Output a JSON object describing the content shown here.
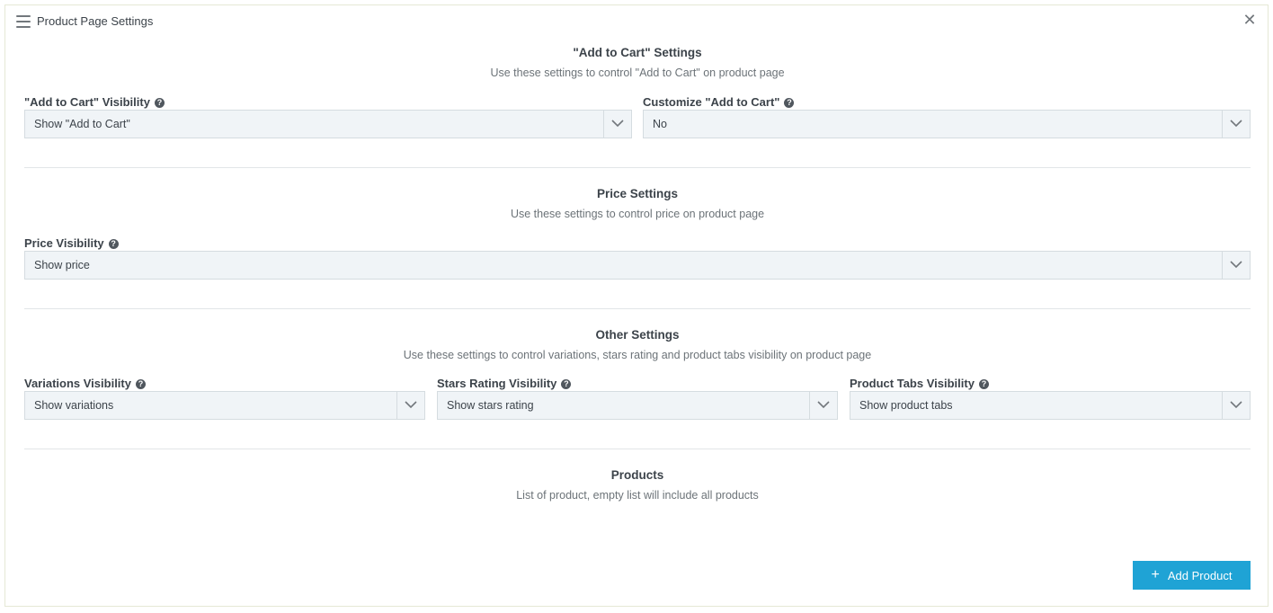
{
  "header": {
    "title": "Product Page Settings",
    "menu_icon": "hamburger-icon",
    "close_icon": "close-icon"
  },
  "add_to_cart": {
    "title": "\"Add to Cart\" Settings",
    "description": "Use these settings to control \"Add to Cart\" on product page",
    "visibility": {
      "label": "\"Add to Cart\" Visibility",
      "value": "Show \"Add to Cart\""
    },
    "customize": {
      "label": "Customize \"Add to Cart\"",
      "value": "No"
    }
  },
  "price": {
    "title": "Price Settings",
    "description": "Use these settings to control price on product page",
    "visibility": {
      "label": "Price Visibility",
      "value": "Show price"
    }
  },
  "other": {
    "title": "Other Settings",
    "description": "Use these settings to control variations, stars rating and product tabs visibility on product page",
    "variations": {
      "label": "Variations Visibility",
      "value": "Show variations"
    },
    "stars": {
      "label": "Stars Rating Visibility",
      "value": "Show stars rating"
    },
    "tabs": {
      "label": "Product Tabs Visibility",
      "value": "Show product tabs"
    }
  },
  "products": {
    "title": "Products",
    "description": "List of product, empty list will include all products",
    "add_label": "Add Product"
  },
  "colors": {
    "accent": "#1fa3d5",
    "select_bg": "#f0f4f7",
    "border": "#d5dce0"
  }
}
